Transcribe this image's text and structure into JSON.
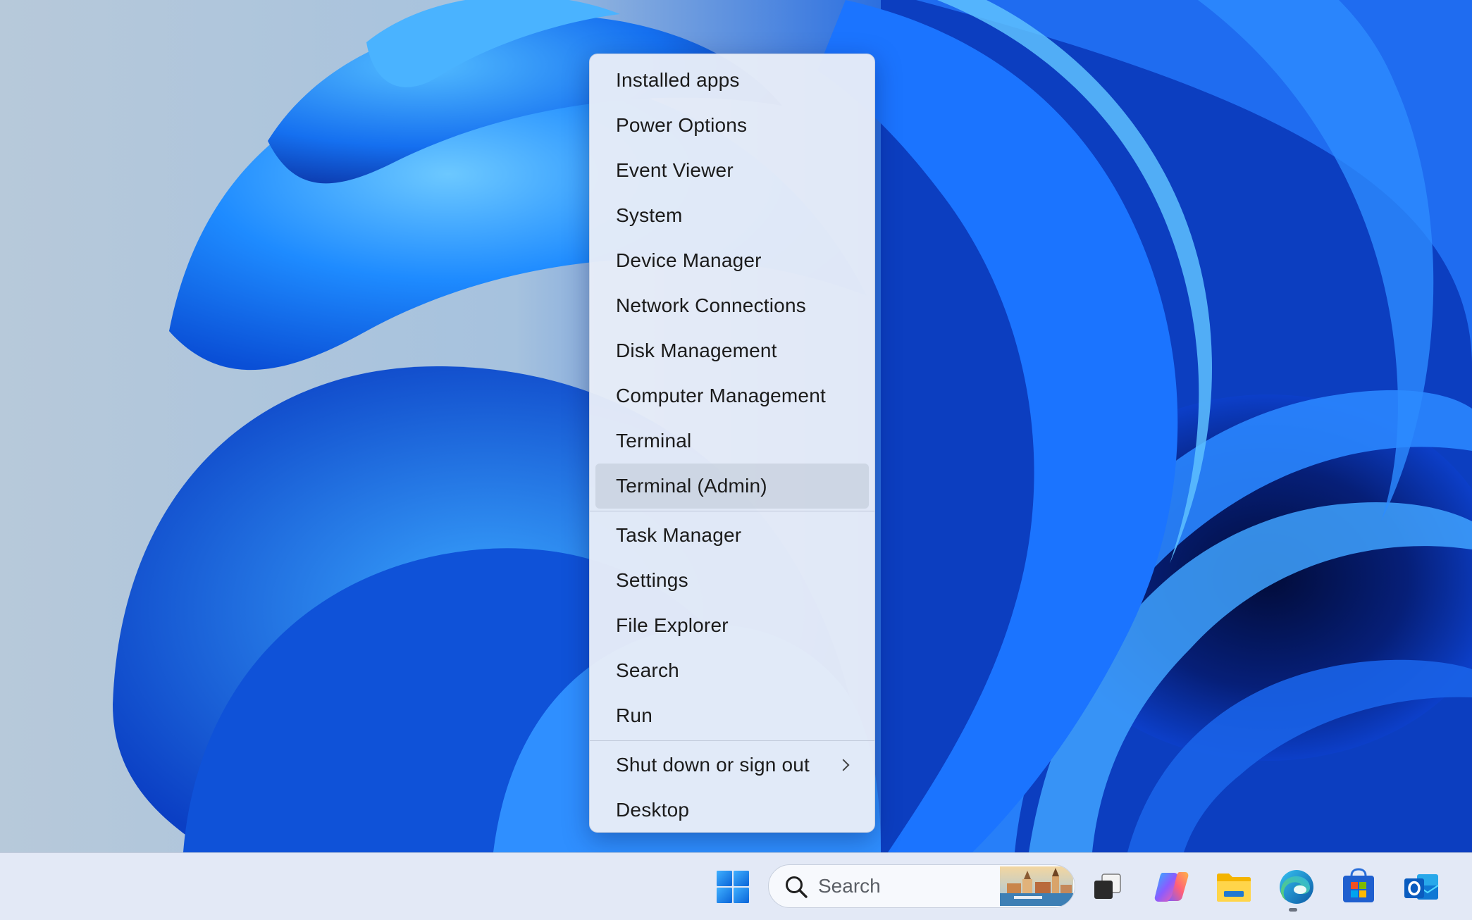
{
  "menu": {
    "groups": [
      [
        {
          "label": "Installed apps"
        },
        {
          "label": "Power Options"
        },
        {
          "label": "Event Viewer"
        },
        {
          "label": "System"
        },
        {
          "label": "Device Manager"
        },
        {
          "label": "Network Connections"
        },
        {
          "label": "Disk Management"
        },
        {
          "label": "Computer Management"
        },
        {
          "label": "Terminal"
        },
        {
          "label": "Terminal (Admin)",
          "hovered": true
        }
      ],
      [
        {
          "label": "Task Manager"
        },
        {
          "label": "Settings"
        },
        {
          "label": "File Explorer"
        },
        {
          "label": "Search"
        },
        {
          "label": "Run"
        }
      ],
      [
        {
          "label": "Shut down or sign out",
          "submenu": true
        },
        {
          "label": "Desktop"
        }
      ]
    ]
  },
  "taskbar": {
    "search_placeholder": "Search",
    "icons": {
      "start": "windows-start-icon",
      "task_view": "task-view-icon",
      "copilot": "copilot-icon",
      "file_explorer": "file-explorer-icon",
      "edge": "edge-browser-icon",
      "store": "microsoft-store-icon",
      "outlook": "outlook-icon"
    }
  },
  "colors": {
    "accent": "#0067c0",
    "wallpaper_light": "#5ab4ff",
    "wallpaper_dark": "#0a2a8a",
    "menu_bg": "#e8edf8"
  }
}
